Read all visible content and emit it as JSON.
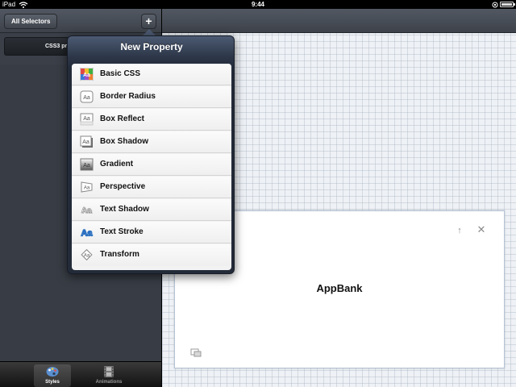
{
  "status_bar": {
    "device": "iPad",
    "time": "9:44"
  },
  "sidebar": {
    "all_selectors_label": "All Selectors",
    "add_label": "+",
    "selector_text": "CSS3 pr"
  },
  "tabbar": {
    "tabs": [
      {
        "label": "Styles",
        "icon": "palette-icon",
        "selected": true
      },
      {
        "label": "Animations",
        "icon": "film-icon",
        "selected": false
      }
    ]
  },
  "popover": {
    "title": "New Property",
    "items": [
      {
        "label": "Basic CSS",
        "icon": "basic-css-icon"
      },
      {
        "label": "Border Radius",
        "icon": "border-radius-icon"
      },
      {
        "label": "Box Reflect",
        "icon": "box-reflect-icon"
      },
      {
        "label": "Box Shadow",
        "icon": "box-shadow-icon"
      },
      {
        "label": "Gradient",
        "icon": "gradient-icon"
      },
      {
        "label": "Perspective",
        "icon": "perspective-icon"
      },
      {
        "label": "Text Shadow",
        "icon": "text-shadow-icon"
      },
      {
        "label": "Text Stroke",
        "icon": "text-stroke-icon"
      },
      {
        "label": "Transform",
        "icon": "transform-icon"
      }
    ]
  },
  "preview": {
    "text": "AppBank"
  }
}
